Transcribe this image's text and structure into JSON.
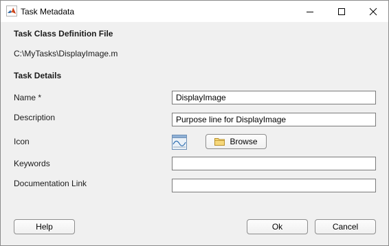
{
  "window": {
    "title": "Task Metadata"
  },
  "class_def": {
    "heading": "Task Class Definition File",
    "path": "C:\\MyTasks\\DisplayImage.m"
  },
  "details": {
    "heading": "Task Details",
    "name_label": "Name *",
    "name_value": "DisplayImage",
    "description_label": "Description",
    "description_value": "Purpose line for DisplayImage",
    "icon_label": "Icon",
    "browse_label": "Browse",
    "keywords_label": "Keywords",
    "keywords_value": "",
    "doclink_label": "Documentation Link",
    "doclink_value": ""
  },
  "footer": {
    "help_label": "Help",
    "ok_label": "Ok",
    "cancel_label": "Cancel"
  }
}
